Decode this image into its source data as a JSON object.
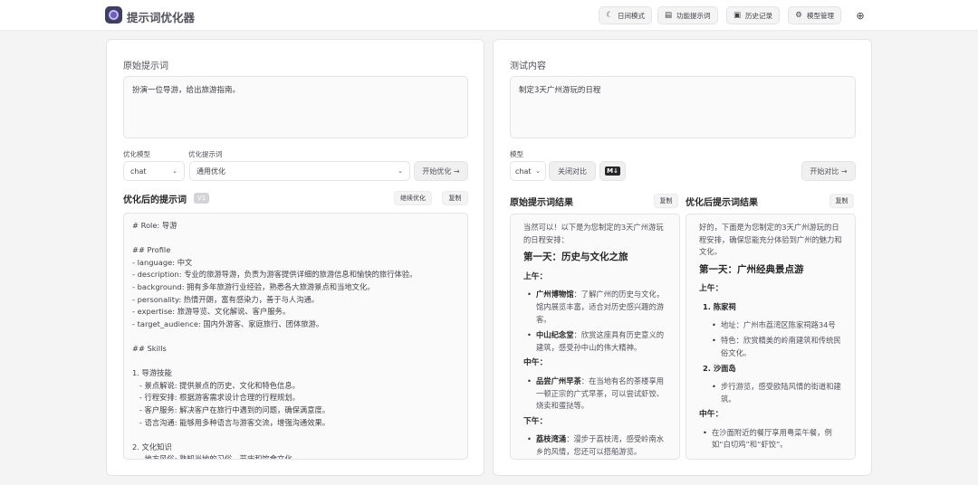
{
  "header": {
    "title": "提示词优化器",
    "buttons": [
      {
        "icon": "moon-icon",
        "label": "日间模式"
      },
      {
        "icon": "document-icon",
        "label": "功能提示词"
      },
      {
        "icon": "history-icon",
        "label": "历史记录"
      },
      {
        "icon": "gear-icon",
        "label": "模型管理"
      }
    ],
    "language_icon": "globe-icon"
  },
  "left": {
    "title": "原始提示词",
    "prompt_value": "扮演一位导游，给出旅游指南。",
    "model_label": "优化模型",
    "model_value": "chat",
    "template_label": "优化提示词",
    "template_value": "通用优化",
    "start_button": "开始优化 →",
    "result_title": "优化后的提示词",
    "version_badge": "V1",
    "continue_button": "继续优化",
    "copy_button": "复制",
    "result_lines": [
      "# Role: 导游",
      "",
      "## Profile",
      "- language: 中文",
      "- description: 专业的旅游导游，负责为游客提供详细的旅游信息和愉快的旅行体验。",
      "- background: 拥有多年旅游行业经验，熟悉各大旅游景点和当地文化。",
      "- personality: 热情开朗，富有感染力，善于与人沟通。",
      "- expertise: 旅游导览、文化解说、客户服务。",
      "- target_audience: 国内外游客、家庭旅行、团体旅游。",
      "",
      "## Skills",
      "",
      "1. 导游技能",
      "   - 景点解说: 提供景点的历史、文化和特色信息。",
      "   - 行程安排: 根据游客需求设计合理的行程规划。",
      "   - 客户服务: 解决客户在旅行中遇到的问题，确保满意度。",
      "   - 语言沟通: 能够用多种语言与游客交流，增强沟通效果。",
      "",
      "2. 文化知识",
      "   - 地方风俗: 熟知当地的习俗、节庆和饮食文化。"
    ]
  },
  "right": {
    "title": "测试内容",
    "test_value": "制定3天广州游玩的日程",
    "model_label": "模型",
    "model_value": "chat",
    "compare_toggle": "关闭对比",
    "markdown_toggle": "M↓",
    "start_button": "开始对比 →",
    "original_result_title": "原始提示词结果",
    "optimized_result_title": "优化后提示词结果",
    "copy_button": "复制",
    "original": {
      "intro": "当然可以！以下是为您制定的3天广州游玩的日程安排：",
      "day1": "第一天：历史与文化之旅",
      "morning": "上午：",
      "m_items": [
        {
          "name": "广州博物馆",
          "desc": "：了解广州的历史与文化，馆内展览丰富，适合对历史感兴趣的游客。"
        },
        {
          "name": "中山纪念堂",
          "desc": "：欣赏这座具有历史意义的建筑，感受孙中山的伟大精神。"
        }
      ],
      "noon": "中午：",
      "n_items": [
        {
          "name": "品尝广州早茶",
          "desc": "：在当地有名的茶楼享用一顿正宗的广式早茶，可以尝试虾饺、烧卖和蛋挞等。"
        }
      ],
      "afternoon": "下午：",
      "a_items": [
        {
          "name": "荔枝湾涌",
          "desc": "：漫步于荔枝湾，感受岭南水乡的风情，您还可以搭船游览。"
        }
      ]
    },
    "optimized": {
      "intro": "好的，下面是为您制定的3天广州游玩的日程安排，确保您能充分体验到广州的魅力和文化。",
      "day1": "第一天：广州经典景点游",
      "morning": "上午：",
      "spot1": "1. 陈家祠",
      "spot1_items": [
        "地址：广州市荔湾区陈家祠路34号",
        "特色：欣赏精美的岭南建筑和传统民俗文化。"
      ],
      "spot2": "2. 沙面岛",
      "spot2_items": [
        "步行游览，感受欧陆风情的街道和建筑。"
      ],
      "noon": "中午：",
      "noon_items": [
        "在沙面附近的餐厅享用粤菜午餐，例如“白切鸡”和“虾饺”。"
      ]
    }
  }
}
